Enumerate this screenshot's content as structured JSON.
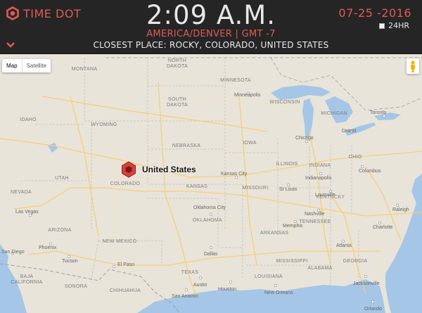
{
  "header": {
    "logo_text": "TIME DOT",
    "time": "2:09 A.M.",
    "timezone": "AMERICA/DENVER | GMT -7",
    "closest_place": "CLOSEST PLACE: ROCKY, COLORADO, UNITED STATES",
    "date": "07-25 -2016",
    "format_label": "24HR"
  },
  "map": {
    "controls": {
      "map_label": "Map",
      "satellite_label": "Satellite"
    },
    "marker_label": "United States",
    "region_labels": [
      "MONTANA",
      "NORTH DAKOTA",
      "MINNESOTA",
      "SOUTH DAKOTA",
      "WISCONSIN",
      "MICHIGAN",
      "WYOMING",
      "NEBRASKA",
      "IOWA",
      "IDAHO",
      "NEVADA",
      "UTAH",
      "COLORADO",
      "KANSAS",
      "MISSOURI",
      "ILLINOIS",
      "INDIANA",
      "OHIO",
      "KENTUCKY",
      "TENNESSEE",
      "OKLAHOMA",
      "ARKANSAS",
      "ARIZONA",
      "NEW MEXICO",
      "TEXAS",
      "MISSISSIPPI",
      "ALABAMA",
      "GEORGIA",
      "LOUISIANA",
      "SONORA",
      "BAJA",
      "CHIHUAHUA"
    ],
    "city_labels": [
      "Minneapolis",
      "Chicago",
      "Detroit",
      "Toronto",
      "Las Vegas",
      "Kansas City",
      "Indianapolis",
      "Columbus",
      "Louisville",
      "St Louis",
      "Nashville",
      "Memphis",
      "Oklahoma City",
      "Dallas",
      "Austin",
      "Houston",
      "San Antonio",
      "El Paso",
      "Phoenix",
      "Tucson",
      "San Diego",
      "Atlanta",
      "Jacksonville",
      "Orlando",
      "New Orleans",
      "Charlotte",
      "Raleigh"
    ],
    "colors": {
      "land": "#e8e4da",
      "water": "#a5c6e6",
      "roads": "#f7cf73",
      "accent": "#e05a54"
    }
  }
}
